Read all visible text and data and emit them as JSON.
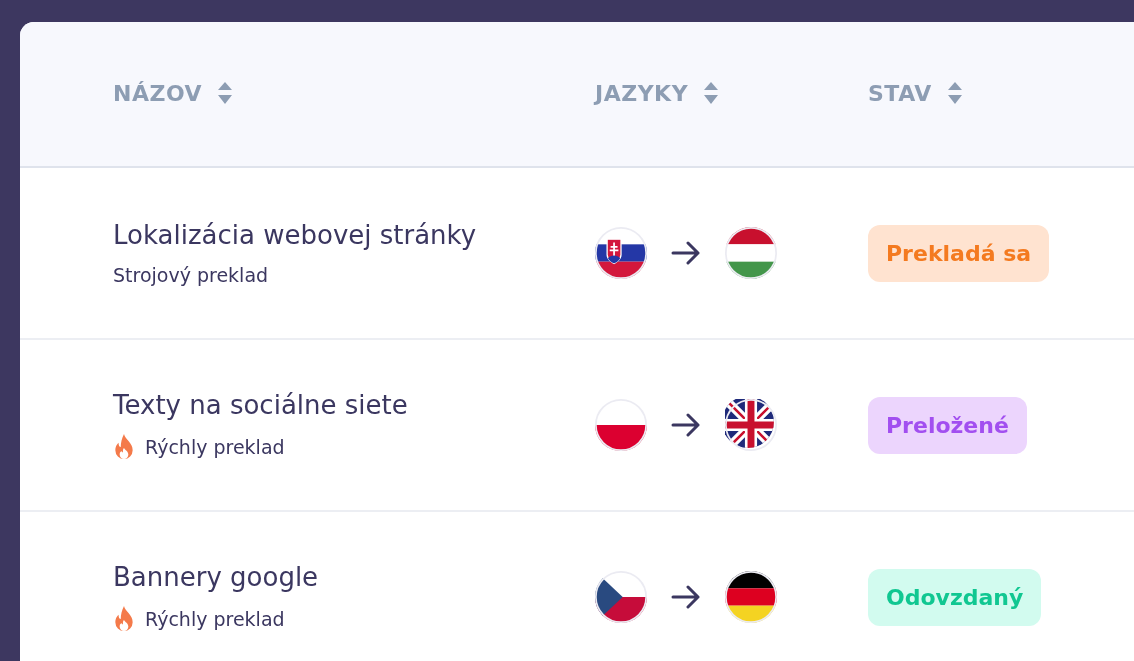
{
  "table": {
    "columns": [
      {
        "label": "NÁZOV"
      },
      {
        "label": "JAZYKY"
      },
      {
        "label": "STAV"
      }
    ],
    "rows": [
      {
        "title": "Lokalizácia webovej stránky",
        "subtitle": "Strojový preklad",
        "express": false,
        "source_flag": {
          "kind": "sk"
        },
        "target_flag": {
          "kind": "hu"
        },
        "status": {
          "label": "Prekladá sa",
          "kind": "translating"
        }
      },
      {
        "title": "Texty na sociálne siete",
        "subtitle": "Rýchly preklad",
        "express": true,
        "source_flag": {
          "kind": "pl"
        },
        "target_flag": {
          "kind": "gb"
        },
        "status": {
          "label": "Preložené",
          "kind": "translated"
        }
      },
      {
        "title": "Bannery google",
        "subtitle": "Rýchly preklad",
        "express": true,
        "source_flag": {
          "kind": "cz"
        },
        "target_flag": {
          "kind": "de"
        },
        "status": {
          "label": "Odovzdaný",
          "kind": "delivered"
        }
      }
    ]
  }
}
